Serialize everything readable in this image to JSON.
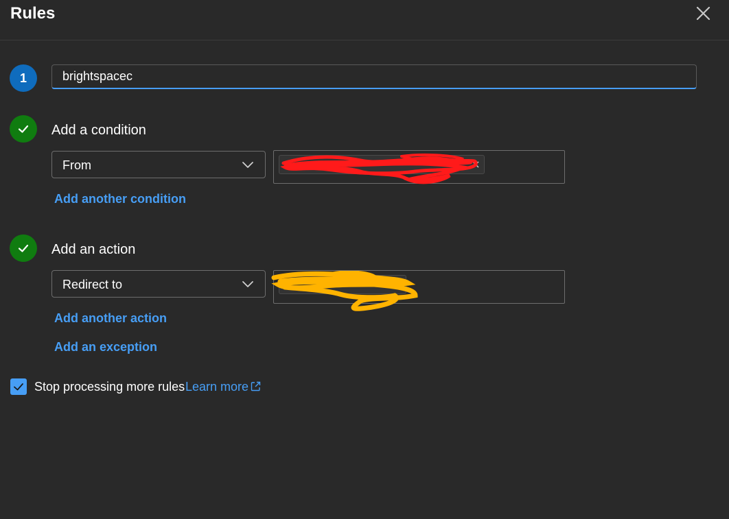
{
  "header": {
    "title": "Rules",
    "close_icon": "close-icon"
  },
  "step1": {
    "number": "1",
    "name_value": "brightspacec"
  },
  "condition": {
    "title": "Add a condition",
    "dropdown_value": "From",
    "add_link": "Add another condition",
    "redaction_color": "#ff1a1a"
  },
  "action": {
    "title": "Add an action",
    "dropdown_value": "Redirect to",
    "add_link": "Add another action",
    "exception_link": "Add an exception",
    "redaction_color": "#ffb300"
  },
  "footer": {
    "checkbox_checked": true,
    "checkbox_label": "Stop processing more rules",
    "learn_more": "Learn more",
    "external_icon": "external-link-icon"
  },
  "colors": {
    "background": "#292929",
    "accent_link": "#479ef5",
    "step_blue": "#0f6cbd",
    "step_green": "#107c10"
  }
}
